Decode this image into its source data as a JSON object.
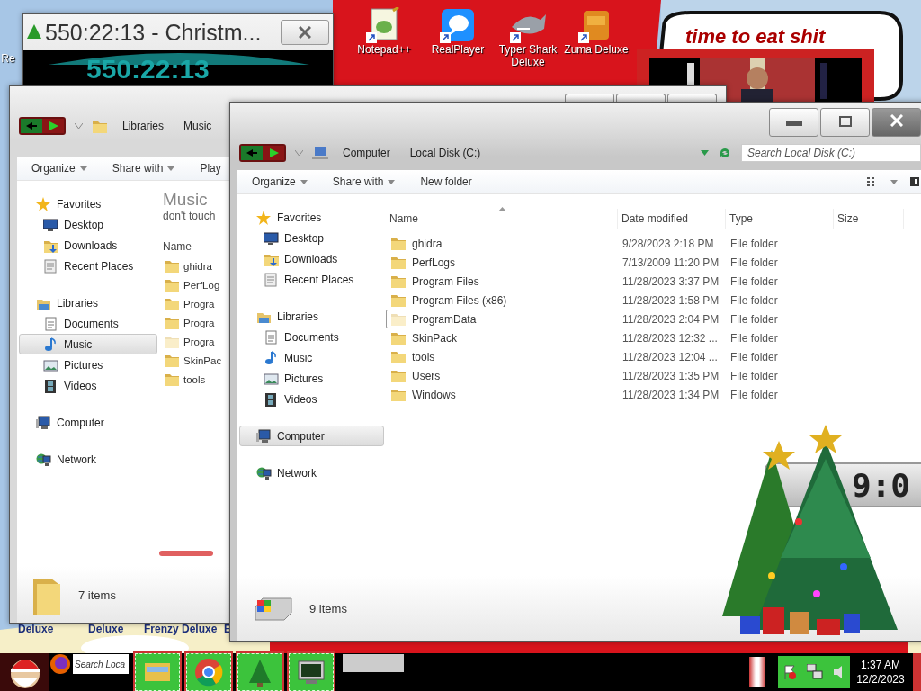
{
  "desktop_icons_top": [
    {
      "label": "Re",
      "kind": "cut"
    },
    {
      "label": "Notepad++",
      "kind": "notepad"
    },
    {
      "label": "RealPlayer",
      "kind": "realplayer"
    },
    {
      "label": "Typer Shark Deluxe",
      "kind": "shark"
    },
    {
      "label": "Zuma Deluxe",
      "kind": "zuma"
    }
  ],
  "desktop_icons_bottom": [
    {
      "label": "Deluxe"
    },
    {
      "label": "Deluxe"
    },
    {
      "label": "Frenzy Deluxe"
    },
    {
      "label": "E"
    }
  ],
  "bubble": {
    "text": "time to eat shit"
  },
  "countdown_window": {
    "title": "550:22:13 - Christm...",
    "display": "550:22:13"
  },
  "music_window": {
    "breadcrumb": [
      "Libraries",
      "Music"
    ],
    "toolbar": [
      {
        "label": "Organize",
        "dropdown": true
      },
      {
        "label": "Share with",
        "dropdown": true
      },
      {
        "label": "Play",
        "dropdown": false
      }
    ],
    "nav": [
      {
        "label": "Favorites",
        "kind": "star",
        "selected": false,
        "children": [
          {
            "label": "Desktop",
            "kind": "desktop",
            "selected": false
          },
          {
            "label": "Downloads",
            "kind": "downloads",
            "selected": false
          },
          {
            "label": "Recent Places",
            "kind": "recent",
            "selected": false
          }
        ]
      },
      {
        "label": "Libraries",
        "kind": "library",
        "selected": false,
        "children": [
          {
            "label": "Documents",
            "kind": "documents",
            "selected": false
          },
          {
            "label": "Music",
            "kind": "music",
            "selected": true
          },
          {
            "label": "Pictures",
            "kind": "pictures",
            "selected": false
          },
          {
            "label": "Videos",
            "kind": "videos",
            "selected": false
          }
        ]
      },
      {
        "label": "Computer",
        "kind": "computer",
        "selected": false
      },
      {
        "label": "Network",
        "kind": "network",
        "selected": false
      }
    ],
    "heading": "Music",
    "subheading": "don't touch",
    "columns": [
      "Name"
    ],
    "files": [
      {
        "name": "ghidra",
        "faded": false
      },
      {
        "name": "PerfLog",
        "faded": false
      },
      {
        "name": "Progra",
        "faded": false
      },
      {
        "name": "Progra",
        "faded": false
      },
      {
        "name": "Progra",
        "faded": true
      },
      {
        "name": "SkinPac",
        "faded": false
      },
      {
        "name": "tools",
        "faded": false
      }
    ],
    "status": "7 items"
  },
  "disk_window": {
    "breadcrumb": [
      "Computer",
      "Local Disk (C:)"
    ],
    "search_placeholder": "Search Local Disk (C:)",
    "toolbar": [
      {
        "label": "Organize",
        "dropdown": true
      },
      {
        "label": "Share with",
        "dropdown": true
      },
      {
        "label": "New folder",
        "dropdown": false
      }
    ],
    "nav": [
      {
        "label": "Favorites",
        "kind": "star",
        "selected": false,
        "children": [
          {
            "label": "Desktop",
            "kind": "desktop",
            "selected": false
          },
          {
            "label": "Downloads",
            "kind": "downloads",
            "selected": false
          },
          {
            "label": "Recent Places",
            "kind": "recent",
            "selected": false
          }
        ]
      },
      {
        "label": "Libraries",
        "kind": "library",
        "selected": false,
        "children": [
          {
            "label": "Documents",
            "kind": "documents",
            "selected": false
          },
          {
            "label": "Music",
            "kind": "music",
            "selected": false
          },
          {
            "label": "Pictures",
            "kind": "pictures",
            "selected": false
          },
          {
            "label": "Videos",
            "kind": "videos",
            "selected": false
          }
        ]
      },
      {
        "label": "Computer",
        "kind": "computer",
        "selected": true
      },
      {
        "label": "Network",
        "kind": "network",
        "selected": false
      }
    ],
    "columns": [
      "Name",
      "Date modified",
      "Type",
      "Size"
    ],
    "files": [
      {
        "name": "ghidra",
        "date": "9/28/2023 2:18 PM",
        "type": "File folder",
        "faded": false,
        "focused": false
      },
      {
        "name": "PerfLogs",
        "date": "7/13/2009 11:20 PM",
        "type": "File folder",
        "faded": false,
        "focused": false
      },
      {
        "name": "Program Files",
        "date": "11/28/2023 3:37 PM",
        "type": "File folder",
        "faded": false,
        "focused": false
      },
      {
        "name": "Program Files (x86)",
        "date": "11/28/2023 1:58 PM",
        "type": "File folder",
        "faded": false,
        "focused": false
      },
      {
        "name": "ProgramData",
        "date": "11/28/2023 2:04 PM",
        "type": "File folder",
        "faded": true,
        "focused": true
      },
      {
        "name": "SkinPack",
        "date": "11/28/2023 12:32 ...",
        "type": "File folder",
        "faded": false,
        "focused": false
      },
      {
        "name": "tools",
        "date": "11/28/2023 12:04 ...",
        "type": "File folder",
        "faded": false,
        "focused": false
      },
      {
        "name": "Users",
        "date": "11/28/2023 1:35 PM",
        "type": "File folder",
        "faded": false,
        "focused": false
      },
      {
        "name": "Windows",
        "date": "11/28/2023 1:34 PM",
        "type": "File folder",
        "faded": false,
        "focused": false
      }
    ],
    "status": "9 items"
  },
  "clock_gadget": {
    "text": "9:0"
  },
  "taskbar": {
    "search_placeholder": "Search Loca",
    "buttons": [
      {
        "kind": "explorer"
      },
      {
        "kind": "chrome"
      },
      {
        "kind": "tree"
      },
      {
        "kind": "monitor"
      }
    ],
    "time": "1:37 AM",
    "date": "12/2/2023"
  }
}
